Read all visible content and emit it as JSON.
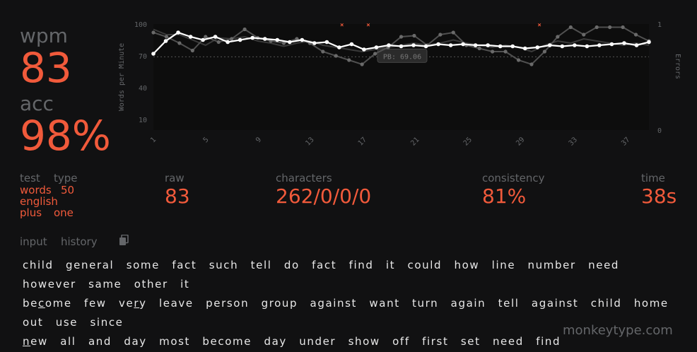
{
  "stats": {
    "wpm_label": "wpm",
    "wpm_value": "83",
    "acc_label": "acc",
    "acc_value": "98%"
  },
  "test_info": {
    "label_test": "test",
    "label_type": "type",
    "mode": "words",
    "count": "50",
    "language": "english",
    "extra_1": "plus",
    "extra_2": "one"
  },
  "bottom_stats": {
    "raw_label": "raw",
    "raw_value": "83",
    "characters_label": "characters",
    "characters_value": "262/0/0/0",
    "consistency_label": "consistency",
    "consistency_value": "81%",
    "time_label": "time",
    "time_value": "38s"
  },
  "tabs": {
    "input": "input",
    "history": "history",
    "copy_icon": "copy-icon"
  },
  "words_text": [
    "child",
    "general",
    "some",
    "fact",
    "such",
    "tell",
    "do",
    "fact",
    "find",
    "it",
    "could",
    "how",
    "line",
    "number",
    "need",
    "however",
    "same",
    "other",
    "it",
    "become",
    "few",
    "very",
    "leave",
    "person",
    "group",
    "against",
    "want",
    "turn",
    "again",
    "tell",
    "against",
    "child",
    "home",
    "out",
    "use",
    "since",
    "new",
    "all",
    "and",
    "day",
    "most",
    "become",
    "day",
    "under",
    "show",
    "off",
    "first",
    "set",
    "need",
    "find"
  ],
  "footer": {
    "site": "monkeytype.com"
  },
  "colors": {
    "background": "#111112",
    "accent": "#f15a3b",
    "text": "#e8e8e8",
    "subtle": "#646669",
    "chart_bg": "#0d0d0d"
  },
  "chart_data": {
    "type": "line",
    "ylabel": "Words per Minute",
    "y2label": "Errors",
    "y_ticks": [
      "100",
      "70",
      "40",
      "10"
    ],
    "y2_ticks": [
      "1",
      "0"
    ],
    "x_ticks": [
      "1",
      "5",
      "9",
      "13",
      "17",
      "21",
      "25",
      "29",
      "33",
      "37"
    ],
    "ylim": [
      0,
      100
    ],
    "xlim": [
      1,
      38
    ],
    "pb_label": "PB: 69.06",
    "pb_value": 69.06,
    "series": [
      {
        "values": [
          72,
          84,
          92,
          88,
          85,
          88,
          83,
          85,
          87,
          86,
          85,
          83,
          85,
          82,
          83,
          78,
          81,
          76,
          78,
          80,
          79,
          80,
          79,
          81,
          80,
          81,
          80,
          80,
          79,
          79,
          77,
          78,
          80,
          79,
          80,
          79,
          80,
          81,
          82,
          80,
          83
        ]
      },
      {
        "values": [
          92,
          88,
          82,
          75,
          88,
          83,
          86,
          95,
          87,
          84,
          82,
          86,
          82,
          74,
          70,
          66,
          62,
          72,
          78,
          88,
          89,
          80,
          90,
          92,
          80,
          77,
          74,
          74,
          66,
          62,
          74,
          88,
          97,
          90,
          97,
          97,
          97,
          90,
          84
        ]
      },
      {
        "values": [
          95,
          90,
          90,
          85,
          80,
          87,
          86,
          88,
          84,
          82,
          79,
          82,
          84,
          80,
          78,
          76,
          74,
          76,
          78,
          80,
          82,
          80,
          82,
          85,
          82,
          80,
          78,
          80,
          78,
          74,
          80,
          84,
          82,
          86,
          84,
          82,
          80,
          82,
          80
        ]
      }
    ],
    "errors_x": [
      15,
      17,
      30
    ]
  }
}
